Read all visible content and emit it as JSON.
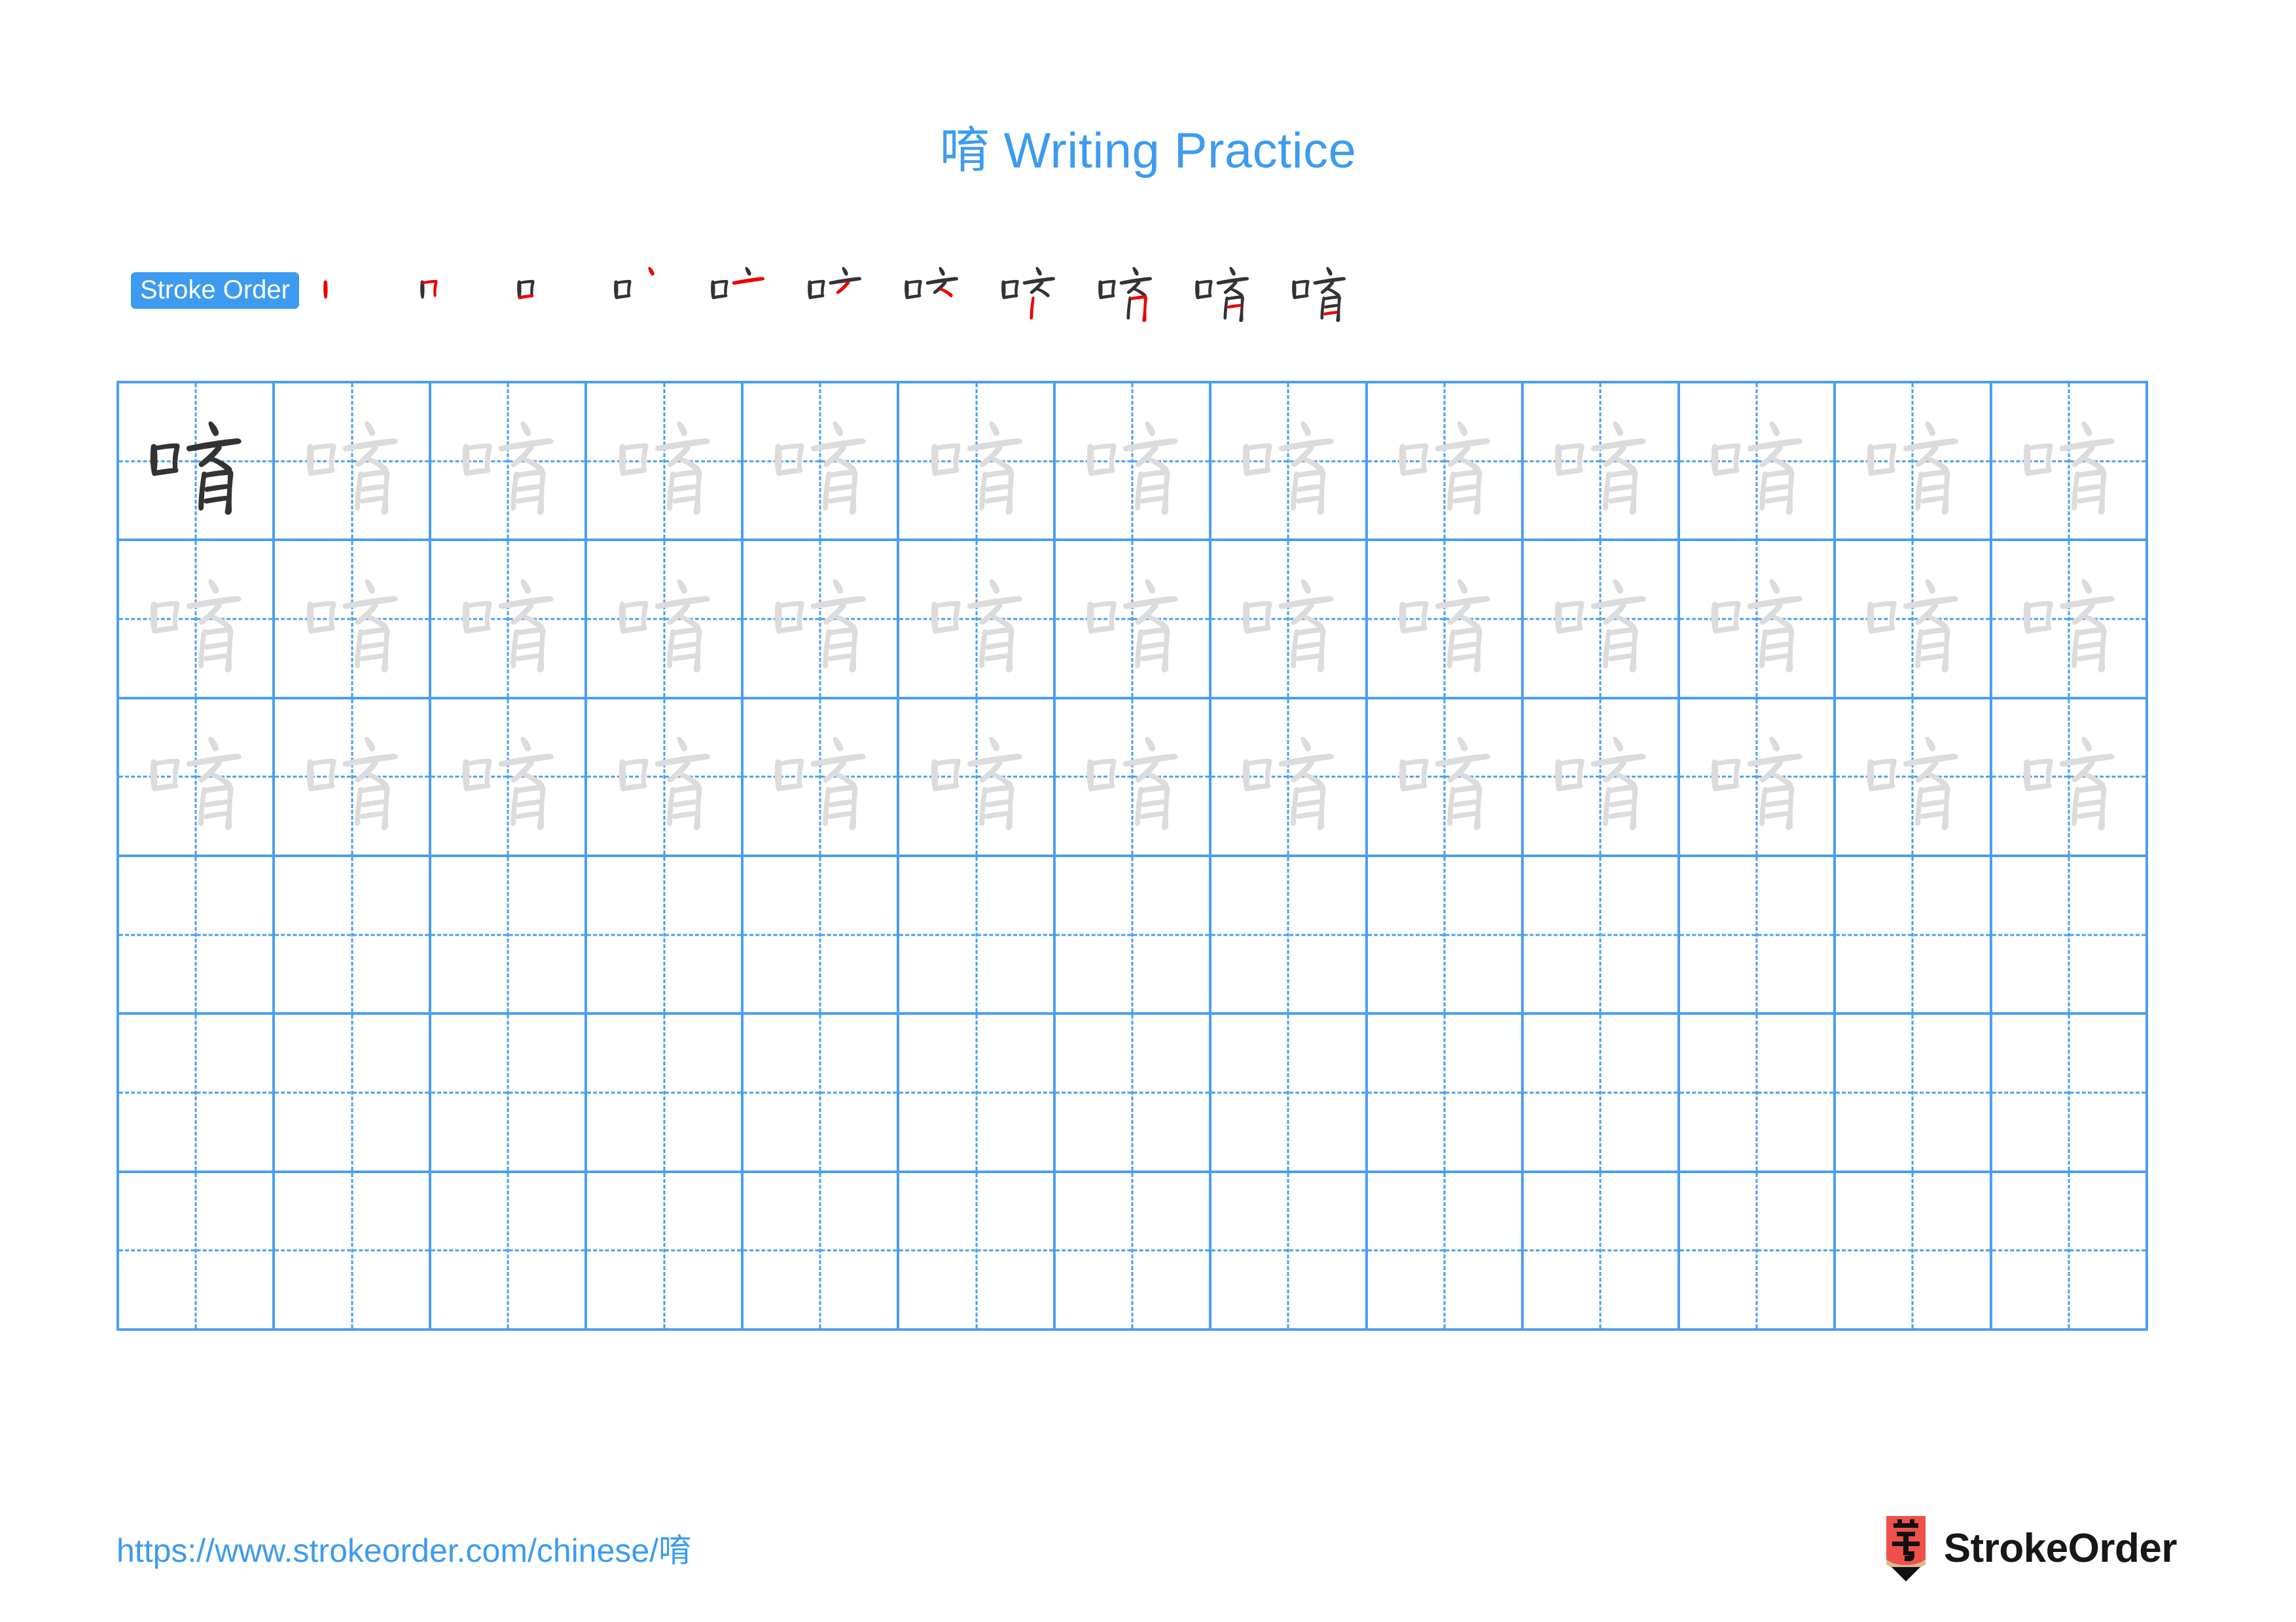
{
  "page": {
    "character": "唷",
    "title": "唷 Writing Practice",
    "accent_blue": "#3d9bf0",
    "grid_blue": "#4a9ff0",
    "ghost_gray": "#dcdcdc",
    "ink_dark": "#333333",
    "new_stroke_red": "#ee0000"
  },
  "stroke_order": {
    "badge_label": "Stroke Order",
    "total_strokes": 11,
    "steps": [
      1,
      2,
      3,
      4,
      5,
      6,
      7,
      8,
      9,
      10,
      11
    ]
  },
  "grid": {
    "columns": 13,
    "rows": 6,
    "model_cell": {
      "row": 1,
      "column": 1
    },
    "ghost_rows": [
      1,
      2,
      3
    ],
    "blank_rows": [
      4,
      5,
      6
    ]
  },
  "footer": {
    "url": "https://www.strokeorder.com/chinese/唷",
    "brand": "StrokeOrder",
    "logo_glyph": "字",
    "logo_body_color": "#f0504a",
    "logo_wood_color": "#d8b894",
    "logo_tip_color": "#111111"
  }
}
